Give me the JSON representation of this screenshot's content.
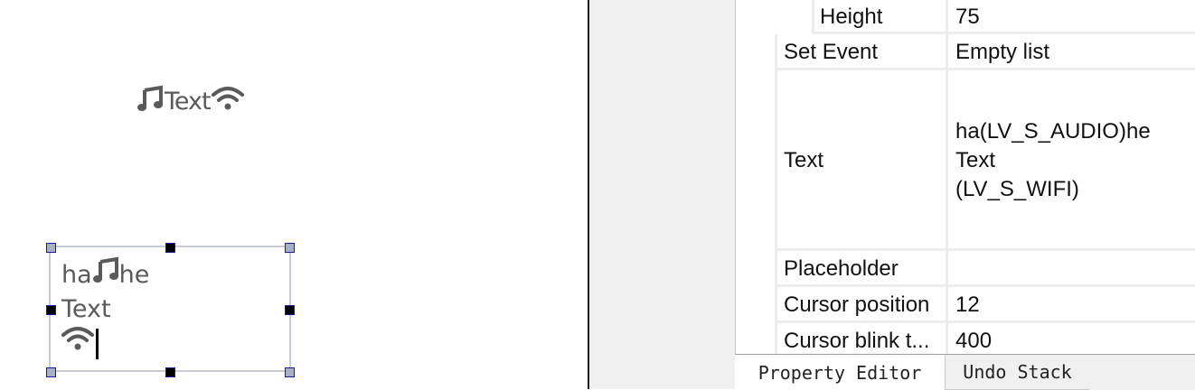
{
  "canvas": {
    "label": {
      "leading_icon": "music-note-icon",
      "text": "Text",
      "trailing_icon": "wifi-icon"
    },
    "textarea": {
      "line1_prefix": "ha",
      "line1_icon": "music-note-icon",
      "line1_suffix": "he",
      "line2": "Text",
      "line3_icon": "wifi-icon"
    }
  },
  "properties": [
    {
      "key": "Height",
      "value": "75"
    },
    {
      "key": "Set Event",
      "value": "Empty list"
    },
    {
      "key": "Text",
      "value_lines": [
        "ha(LV_S_AUDIO)he",
        "Text",
        "(LV_S_WIFI)"
      ]
    },
    {
      "key": "Placeholder",
      "value": ""
    },
    {
      "key": "Cursor position",
      "value": "12"
    },
    {
      "key": "Cursor blink t...",
      "value": "400"
    }
  ],
  "tabs": [
    "Property Editor",
    "Undo Stack"
  ],
  "colors": {
    "handle_corner": "#a9b0c6",
    "handle_mid": "#000000",
    "handle_border": "#1a1aa0",
    "widget_text": "#5a5a5a",
    "divider": "#1e1e1e"
  }
}
